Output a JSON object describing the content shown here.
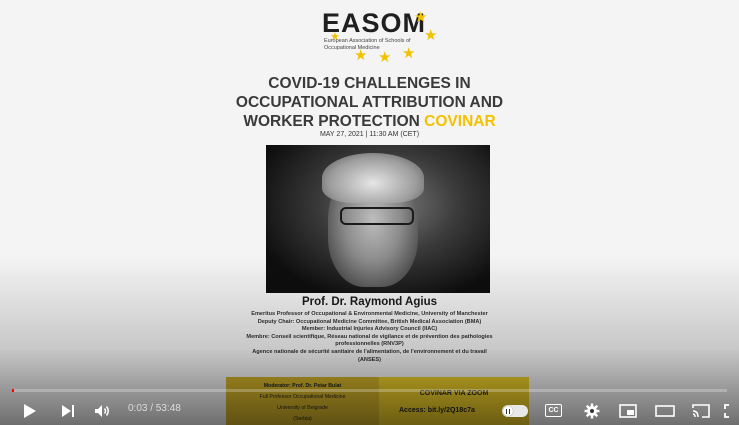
{
  "poster": {
    "logo_word": "EASOM",
    "logo_sub": "European Association of Schools of Occupational Medicine",
    "title_line1": "COVID-19 CHALLENGES IN",
    "title_line2": "OCCUPATIONAL ATTRIBUTION AND",
    "title_line3_main": "WORKER PROTECTION ",
    "title_line3_accent": "COVINAR",
    "date": "MAY 27, 2021 | 11:30 AM (CET)",
    "speaker_name": "Prof. Dr. Raymond Agius",
    "bio": [
      "Emeritus Professor of Occupational & Environmental Medicine, University of Manchester",
      "Deputy Chair: Occupational Medicine Committee, British Medical Association (BMA)",
      "Member: Industrial Injuries Advisory Council (IIAC)",
      "Membre: Conseil scientifique, Réseau national de vigilance et de prévention des pathologies",
      "professionnelles (RNV3P)",
      "Agence nationale de sécurité sanitaire de l'alimentation, de l'environnement et du travail",
      "(ANSES)"
    ],
    "moderator": [
      "Moderator: Prof. Dr. Petar Bulat",
      "Full Professor Occupational Medicine",
      "University of Belgrade",
      "(Serbia)"
    ],
    "zoom_title": "COVINAR VIA ZOOM",
    "zoom_access_label": "Access: ",
    "zoom_link": "bit.ly/2Q18c7a"
  },
  "player": {
    "time_display": "0:03 / 53:48",
    "progress_fraction": 0.001,
    "accent_color": "#ff0000",
    "cc_label": "CC",
    "icons": [
      "play-icon",
      "next-icon",
      "volume-icon",
      "autoplay-toggle",
      "cc-icon",
      "settings-icon",
      "miniplayer-icon",
      "theater-icon",
      "cast-icon",
      "fullscreen-icon"
    ]
  }
}
